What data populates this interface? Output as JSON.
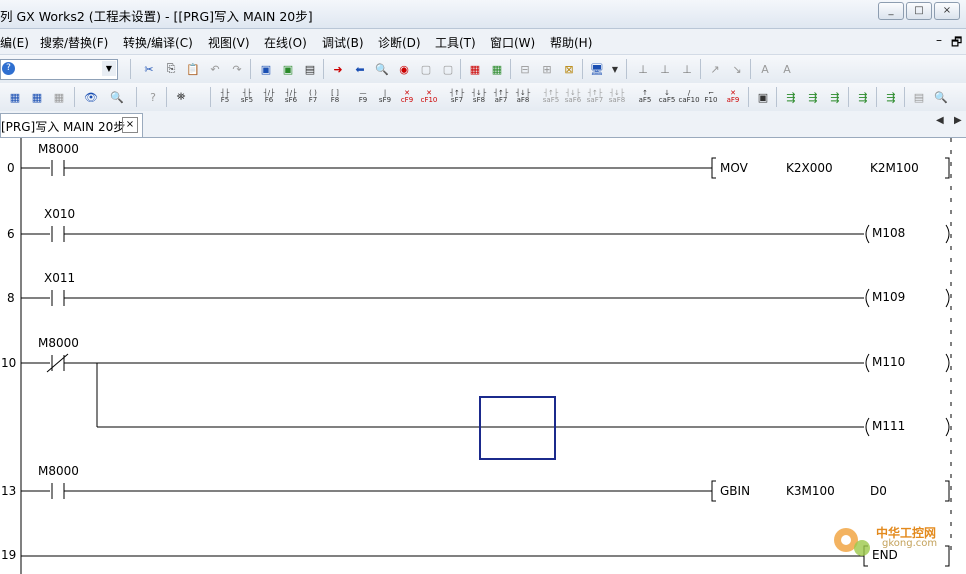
{
  "window": {
    "title": "列 GX Works2 (工程未设置) - [[PRG]写入 MAIN 20步]",
    "btn_min": "_",
    "btn_restore": "□",
    "btn_close": "×"
  },
  "menu": {
    "items": [
      "编(E)",
      "搜索/替换(F)",
      "转换/编译(C)",
      "视图(V)",
      "在线(O)",
      "调试(B)",
      "诊断(D)",
      "工具(T)",
      "窗口(W)",
      "帮助(H)"
    ],
    "sys_min": "–",
    "sys_restore": "🗗"
  },
  "toolbar2": {
    "row2": [
      "F5",
      "sF5",
      "F6",
      "sF6",
      "F7",
      "F8",
      "F9",
      "sF9",
      "cF9",
      "cF10",
      "sF7",
      "sF8",
      "aF7",
      "aF8",
      "saF5",
      "saF6",
      "saF7",
      "saF8",
      "aF5",
      "caF5",
      "caF10",
      "F10",
      "aF9"
    ]
  },
  "tab": {
    "label": "[PRG]写入 MAIN 20步",
    "close": "×"
  },
  "nav": {
    "left": "◀",
    "right": "▶"
  },
  "ladder": {
    "steps": [
      {
        "no": "0",
        "device": "M8000",
        "contact": "NO",
        "instr": "MOV",
        "args": [
          "K2X000",
          "K2M100"
        ]
      },
      {
        "no": "6",
        "device": "X010",
        "contact": "NO",
        "coil": "M108"
      },
      {
        "no": "8",
        "device": "X011",
        "contact": "NO",
        "coil": "M109"
      },
      {
        "no": "10",
        "device": "M8000",
        "contact": "NC",
        "coil": "M110"
      },
      {
        "no": "",
        "device": "",
        "contact": "",
        "coil": "M111"
      },
      {
        "no": "13",
        "device": "M8000",
        "contact": "NO",
        "instr": "GBIN",
        "args": [
          "K3M100",
          "D0"
        ]
      },
      {
        "no": "19",
        "instr": "END"
      }
    ]
  },
  "watermark": {
    "text": "中华工控网",
    "url": "gkong.com"
  },
  "colors": {
    "cursor": "#1b2a8c",
    "watermark": "#e38a1d"
  }
}
